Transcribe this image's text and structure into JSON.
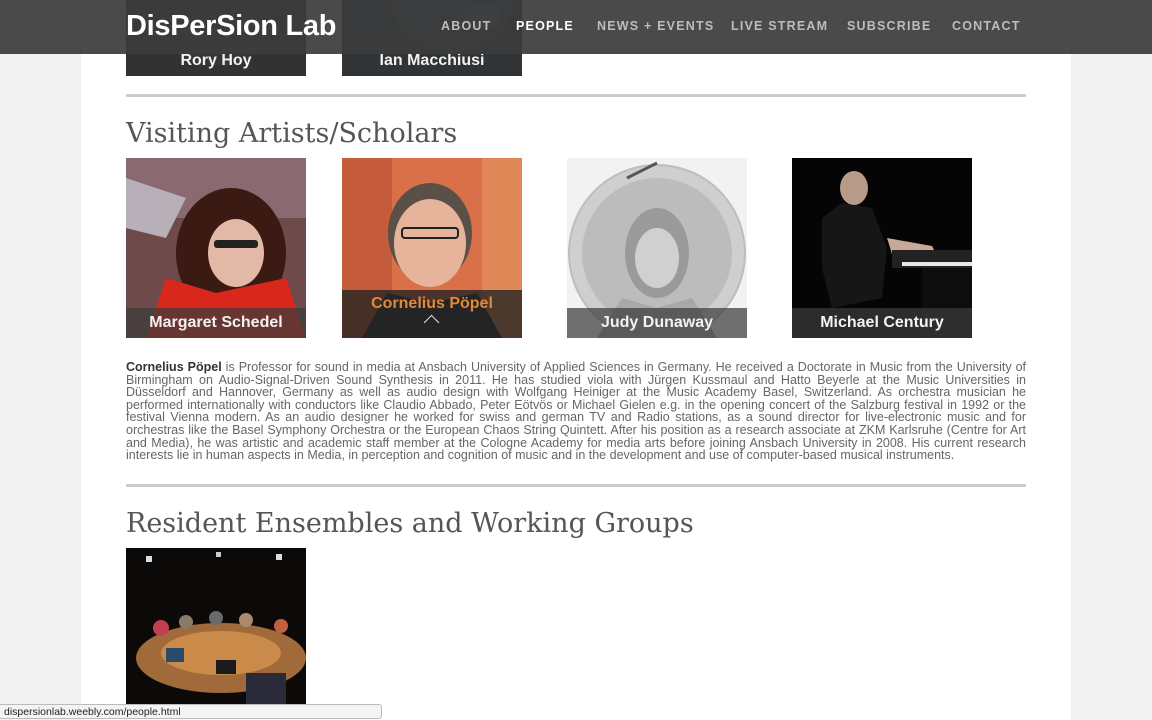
{
  "header": {
    "logo": "DisPerSion Lab",
    "nav": [
      "ABOUT",
      "PEOPLE",
      "NEWS + EVENTS",
      "LIVE STREAM",
      "SUBSCRIBE",
      "CONTACT"
    ],
    "active_nav": "PEOPLE"
  },
  "previous_people": [
    "Rory Hoy",
    "Ian Macchiusi"
  ],
  "visiting": {
    "title": "Visiting Artists/Scholars",
    "people": [
      "Margaret Schedel",
      "Cornelius Pöpel",
      "Judy Dunaway",
      "Michael Century"
    ],
    "active_person": "Cornelius Pöpel",
    "bio_name": "Cornelius Pöpel",
    "bio_text": " is Professor for sound in media at Ansbach University of Applied Sciences in Germany. He received a Doctorate in Music from the University of Birmingham on Audio-Signal-Driven Sound Synthesis in 2011. He has studied viola with Jürgen Kussmaul and Hatto Beyerle at the Music Universities in Düsseldorf and Hannover, Germany as well as audio design with Wolfgang Heiniger at the Music Academy Basel, Switzerland. As orchestra musician he performed internationally with conductors like Claudio Abbado, Peter Eötvös or Michael Gielen e.g. in the opening concert of the Salzburg festival in 1992 or the festival Vienna modern. As an audio designer he worked for swiss and german TV and Radio stations, as a sound director for live-electronic music and for orchestras like the Basel Symphony Orchestra or the European Chaos String Quintett. After his position as a research associate at ZKM Karlsruhe (Centre for Art and Media), he was artistic and academic staff member at the Cologne Academy for media arts before joining Ansbach University in 2008. His current research interests lie in human aspects in Media, in perception and cognition of music and in the development and use of computer-based musical instruments."
  },
  "ensembles": {
    "title": "Resident Ensembles and Working Groups"
  },
  "status_url": "dispersionlab.weebly.com/people.html"
}
